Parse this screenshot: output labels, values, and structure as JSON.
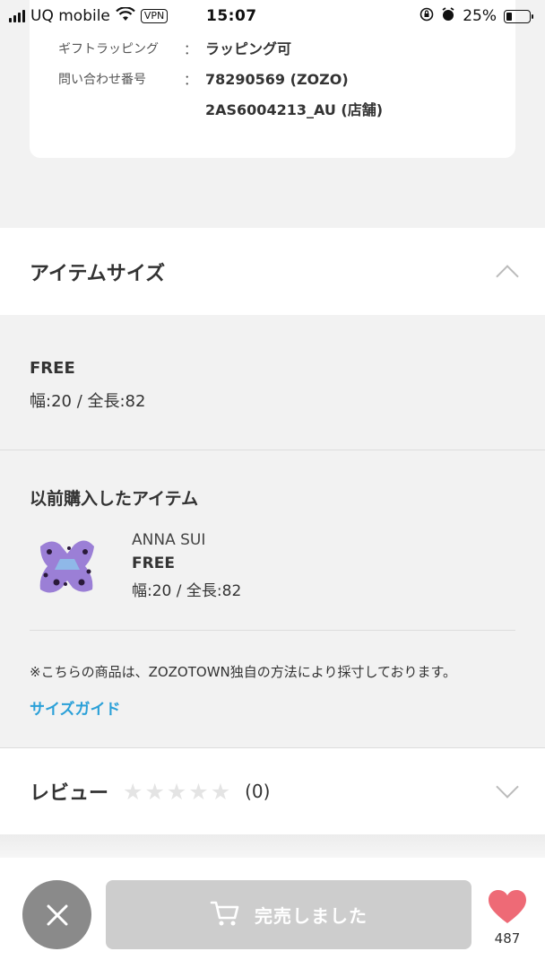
{
  "status_bar": {
    "carrier": "UQ mobile",
    "vpn": "VPN",
    "time": "15:07",
    "battery": "25%",
    "battery_level": 0.25
  },
  "info": {
    "gift_label": "ギフトラッピング",
    "gift_sep": "：",
    "gift_value": "ラッピング可",
    "inquiry_label": "問い合わせ番号",
    "inquiry_sep": "：",
    "inquiry_value_1": "78290569 (ZOZO)",
    "inquiry_value_2": "2AS6004213_AU (店舗)"
  },
  "item_size": {
    "title": "アイテムサイズ",
    "size_name": "FREE",
    "dimensions": "幅:20 / 全長:82"
  },
  "previous": {
    "title": "以前購入したアイテム",
    "brand": "ANNA SUI",
    "size": "FREE",
    "dimensions": "幅:20 / 全長:82"
  },
  "note": "※こちらの商品は、ZOZOTOWN独自の方法により採寸しております。",
  "size_guide_link": "サイズガイド",
  "review": {
    "title": "レビュー",
    "rating": 0,
    "count": "(0)"
  },
  "bottom": {
    "soldout_label": "完売しました",
    "favorite_count": "487"
  },
  "colors": {
    "accent_link": "#2aa0d8",
    "heart": "#ee6a76",
    "disabled_button": "#cdcdcd"
  }
}
